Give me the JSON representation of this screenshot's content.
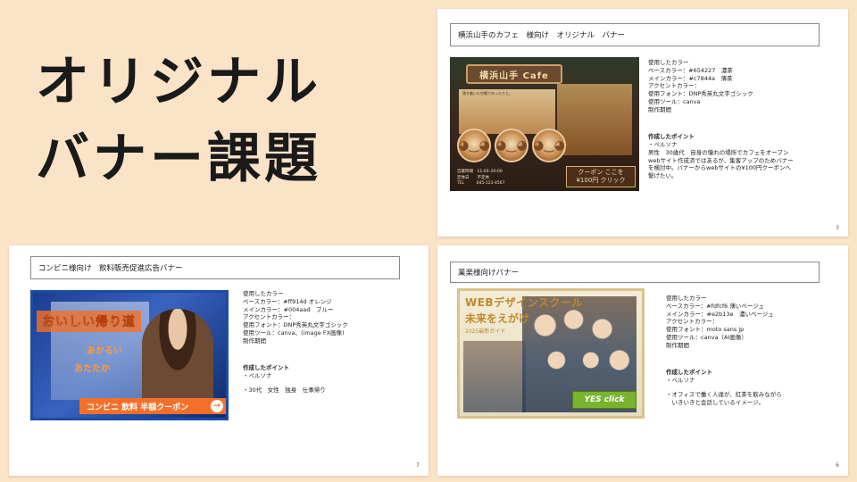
{
  "title": {
    "line1": "オリジナル",
    "line2": "バナー課題"
  },
  "slides": [
    {
      "header": "横浜山手のカフェ　様向け　オリジナル　バナー",
      "banner": {
        "sign": "横浜山手 Cafe",
        "window_text": "落ち着いた空間でゆったりと。",
        "info_lines": [
          "営業時間　11:00–20:00",
          "定休日　　不定休",
          "TEL　　　045-123-4567"
        ],
        "coupon_line1": "クーポン ここを",
        "coupon_line2": "¥100円 クリック"
      },
      "info_rows": [
        "使用したカラー",
        "ベースカラー：#654227　濃茶",
        "メインカラー：#c7844a　薄茶",
        "アクセントカラー：",
        "使用フォント：DNP秀英丸文字ゴシック",
        "使用ツール：canva",
        "制作期間"
      ],
      "points_heading": "作成したポイント",
      "points_rows": [
        "・ペルソナ",
        "男性　30歳代　自身の憧れの場所でカフェをオープン",
        "webサイト作成済ではあるが、集客アップのためバナー",
        "を検討中。バナーからwebサイトの¥100円クーポンへ",
        "繋げたい。"
      ],
      "page_num": "3"
    },
    {
      "header": "コンビニ様向け　飲料販売促進広告バナー",
      "banner": {
        "title": "おいしい帰り道",
        "sub1": "あかるい",
        "sub2": "あたたか",
        "coupon": "コンビニ 飲料 半額クーポン",
        "arrow": "→"
      },
      "info_rows": [
        "使用したカラー",
        "ベースカラー：#ff914d オレンジ",
        "メインカラー：#004aad　ブルー",
        "アクセントカラー：",
        "使用フォント：DNP秀英丸文字ゴシック",
        "使用ツール：canva、(image FX画像)",
        "制作期間"
      ],
      "points_heading": "作成したポイント",
      "points_rows": [
        "・ペルソナ",
        "",
        "・30代　女性　独身　仕事帰り"
      ],
      "page_num": "7"
    },
    {
      "header": "業楽様向けバナー",
      "banner": {
        "title": "WEBデザインスクール",
        "sub": "未来をえがけ",
        "guide": "2025最新ガイド",
        "yes": "YES click"
      },
      "info_rows": [
        "使用したカラー",
        "ベースカラー：#fdfcf6 薄いベージュ",
        "メインカラー：#e2b13e　濃いベージュ",
        "アクセントカラー：",
        "使用フォント：moto sans jp",
        "使用ツール：canva（AI画像）",
        "制作期間"
      ],
      "points_heading": "作成したポイント",
      "points_rows": [
        "・ペルソナ",
        "",
        "・オフィスで働く人達が、紅茶を飲みながら",
        "　いきいきと会話しているイメージ。"
      ],
      "page_num": "6"
    }
  ]
}
